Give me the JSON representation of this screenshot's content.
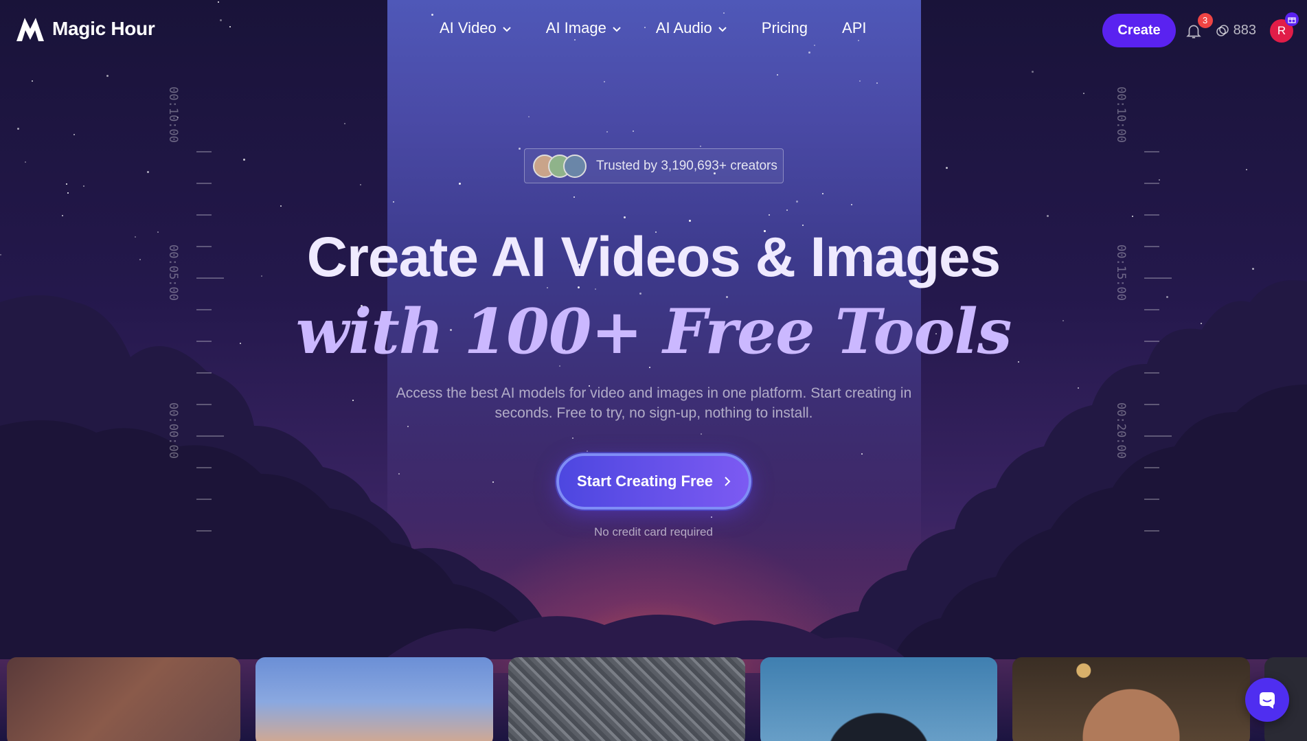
{
  "brand": {
    "name": "Magic Hour"
  },
  "nav": {
    "menu": [
      {
        "label": "AI Video",
        "has_dropdown": true
      },
      {
        "label": "AI Image",
        "has_dropdown": true
      },
      {
        "label": "AI Audio",
        "has_dropdown": true
      },
      {
        "label": "Pricing",
        "has_dropdown": false
      },
      {
        "label": "API",
        "has_dropdown": false
      }
    ],
    "create_label": "Create",
    "notification_count": "3",
    "credits": "883",
    "avatar_initial": "R"
  },
  "hero": {
    "trusted_text": "Trusted by 3,190,693+ creators",
    "title_line1": "Create AI Videos & Images",
    "title_line2": "with 100+ Free Tools",
    "subtitle": "Access the best AI models for video and images in one platform. Start creating in seconds. Free to try, no sign-up, nothing to install.",
    "cta_label": "Start Creating Free",
    "cta_note": "No credit card required"
  },
  "timecodes": {
    "left": [
      "00:10:00",
      "00:05:00",
      "00:00:00"
    ],
    "right": [
      "00:10:00",
      "00:15:00",
      "00:20:00"
    ]
  },
  "colors": {
    "accent": "#5a22f0",
    "badge": "#ef4444",
    "avatar": "#e11d48"
  }
}
